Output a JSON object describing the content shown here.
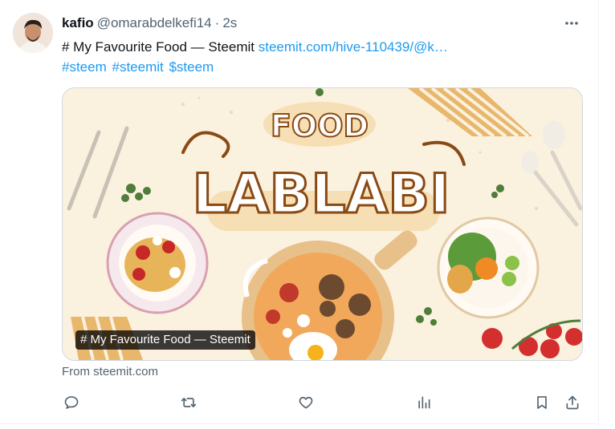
{
  "post": {
    "author_name": "kafio",
    "author_handle": "@omarabdelkefi14",
    "separator": "·",
    "time": "2s",
    "text": "# My Favourite Food — Steemit",
    "link": "steemit.com/hive-110439/@k…",
    "hashtags": [
      "#steem",
      "#steemit",
      "$steem"
    ]
  },
  "card": {
    "label": "# My Favourite Food — Steemit",
    "source": "From steemit.com",
    "artwork": {
      "title_top": "FOOD",
      "title_main": "LABLABI"
    }
  },
  "icons": {
    "more": "more-horizontal-icon",
    "reply": "reply-icon",
    "repost": "repost-icon",
    "like": "heart-icon",
    "views": "analytics-icon",
    "bookmark": "bookmark-icon",
    "share": "share-icon"
  },
  "colors": {
    "link": "#1d9bf0",
    "secondary_text": "#536471",
    "border": "#cfd9de"
  }
}
